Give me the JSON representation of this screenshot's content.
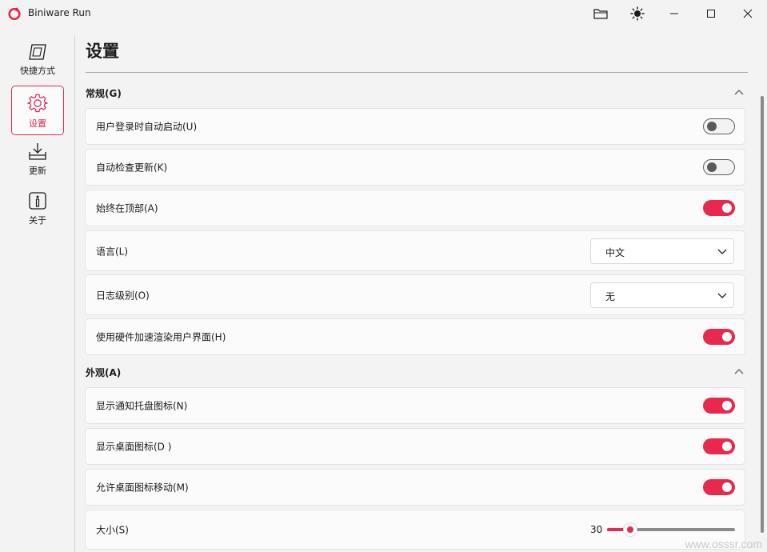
{
  "window": {
    "title": "Biniware Run",
    "accent": "#e8294e"
  },
  "sidebar": {
    "items": [
      {
        "label": "快捷方式",
        "icon": "shortcut-icon"
      },
      {
        "label": "设置",
        "icon": "gear-icon",
        "active": true
      },
      {
        "label": "更新",
        "icon": "download-icon"
      },
      {
        "label": "关于",
        "icon": "info-icon"
      }
    ]
  },
  "page": {
    "title": "设置"
  },
  "sections": {
    "general": {
      "label": "常规(G)"
    },
    "appearance": {
      "label": "外观(A)"
    }
  },
  "settings": {
    "autostart": {
      "label": "用户登录时自动启动(U)",
      "on": false
    },
    "autoupdate": {
      "label": "自动检查更新(K)",
      "on": false
    },
    "ontop": {
      "label": "始终在顶部(A)",
      "on": true
    },
    "language": {
      "label": "语言(L)",
      "value": "中文"
    },
    "loglevel": {
      "label": "日志级别(O)",
      "value": "无"
    },
    "hwaccel": {
      "label": "使用硬件加速渲染用户界面(H)",
      "on": true
    },
    "trayicon": {
      "label": "显示通知托盘图标(N)",
      "on": true
    },
    "desktopicon": {
      "label": "显示桌面图标(D )",
      "on": true
    },
    "movable": {
      "label": "允许桌面图标移动(M)",
      "on": true
    },
    "size": {
      "label": "大小(S)",
      "value": "30",
      "fraction": 0.18
    }
  },
  "watermark": "www.osssr.com"
}
